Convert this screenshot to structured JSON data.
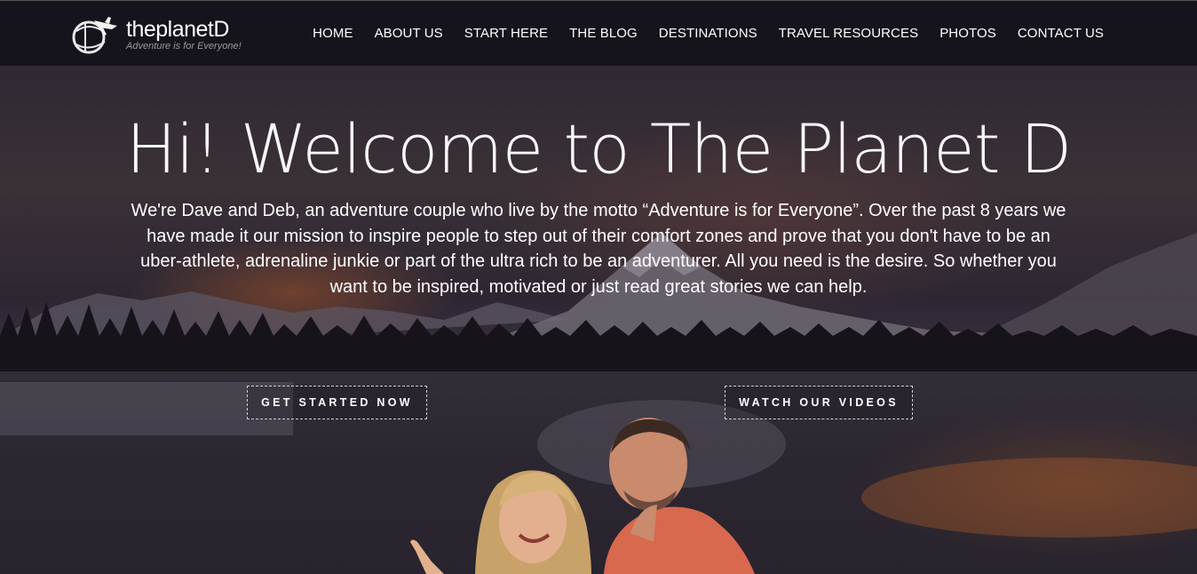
{
  "site": {
    "logo_name": "theplanetD",
    "logo_tagline": "Adventure is for Everyone!"
  },
  "nav": {
    "items": [
      {
        "label": "HOME"
      },
      {
        "label": "ABOUT US"
      },
      {
        "label": "START HERE"
      },
      {
        "label": "THE BLOG"
      },
      {
        "label": "DESTINATIONS"
      },
      {
        "label": "TRAVEL RESOURCES"
      },
      {
        "label": "PHOTOS"
      },
      {
        "label": "CONTACT US"
      }
    ]
  },
  "hero": {
    "title": "Hi! Welcome to The Planet D",
    "intro": "We're Dave and Deb, an adventure couple who live by the motto “Adventure is for Everyone”. Over the past 8 years we have made it our mission to inspire people to step out of their comfort zones and prove that you don't have to be an uber-athlete, adrenaline junkie or part of the ultra rich to be an adventurer. All you need is the desire. So whether you want to be inspired, motivated or just read great stories we can help.",
    "cta_primary": "GET STARTED NOW",
    "cta_secondary": "WATCH OUR VIDEOS"
  },
  "colors": {
    "nav_background": "#15131b",
    "text": "#ffffff",
    "sky_glow": "#d26e28"
  },
  "icons": {
    "logo": "airplane-globe-logo-icon"
  }
}
